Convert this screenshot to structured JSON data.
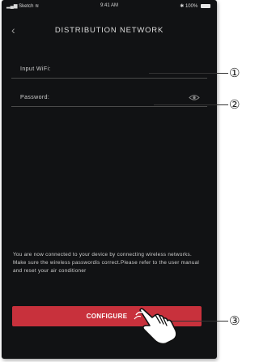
{
  "status_bar": {
    "carrier": "Sketch",
    "time": "9:41 AM",
    "battery": "100%"
  },
  "nav": {
    "title": "DISTRIBUTION NETWORK"
  },
  "form": {
    "wifi_label": "Input WiFi:",
    "password_label": "Password:"
  },
  "description": "You are now connected to your device by connecting wireless networks. Make sure the wireless passwordis correct.Please refer to the user manual and reset your air conditioner",
  "button": {
    "label": "CONFIGURE"
  },
  "callouts": [
    "①",
    "②",
    "③"
  ],
  "colors": {
    "background": "#111214",
    "accent": "#c8313c",
    "text": "#cfcfcf"
  }
}
